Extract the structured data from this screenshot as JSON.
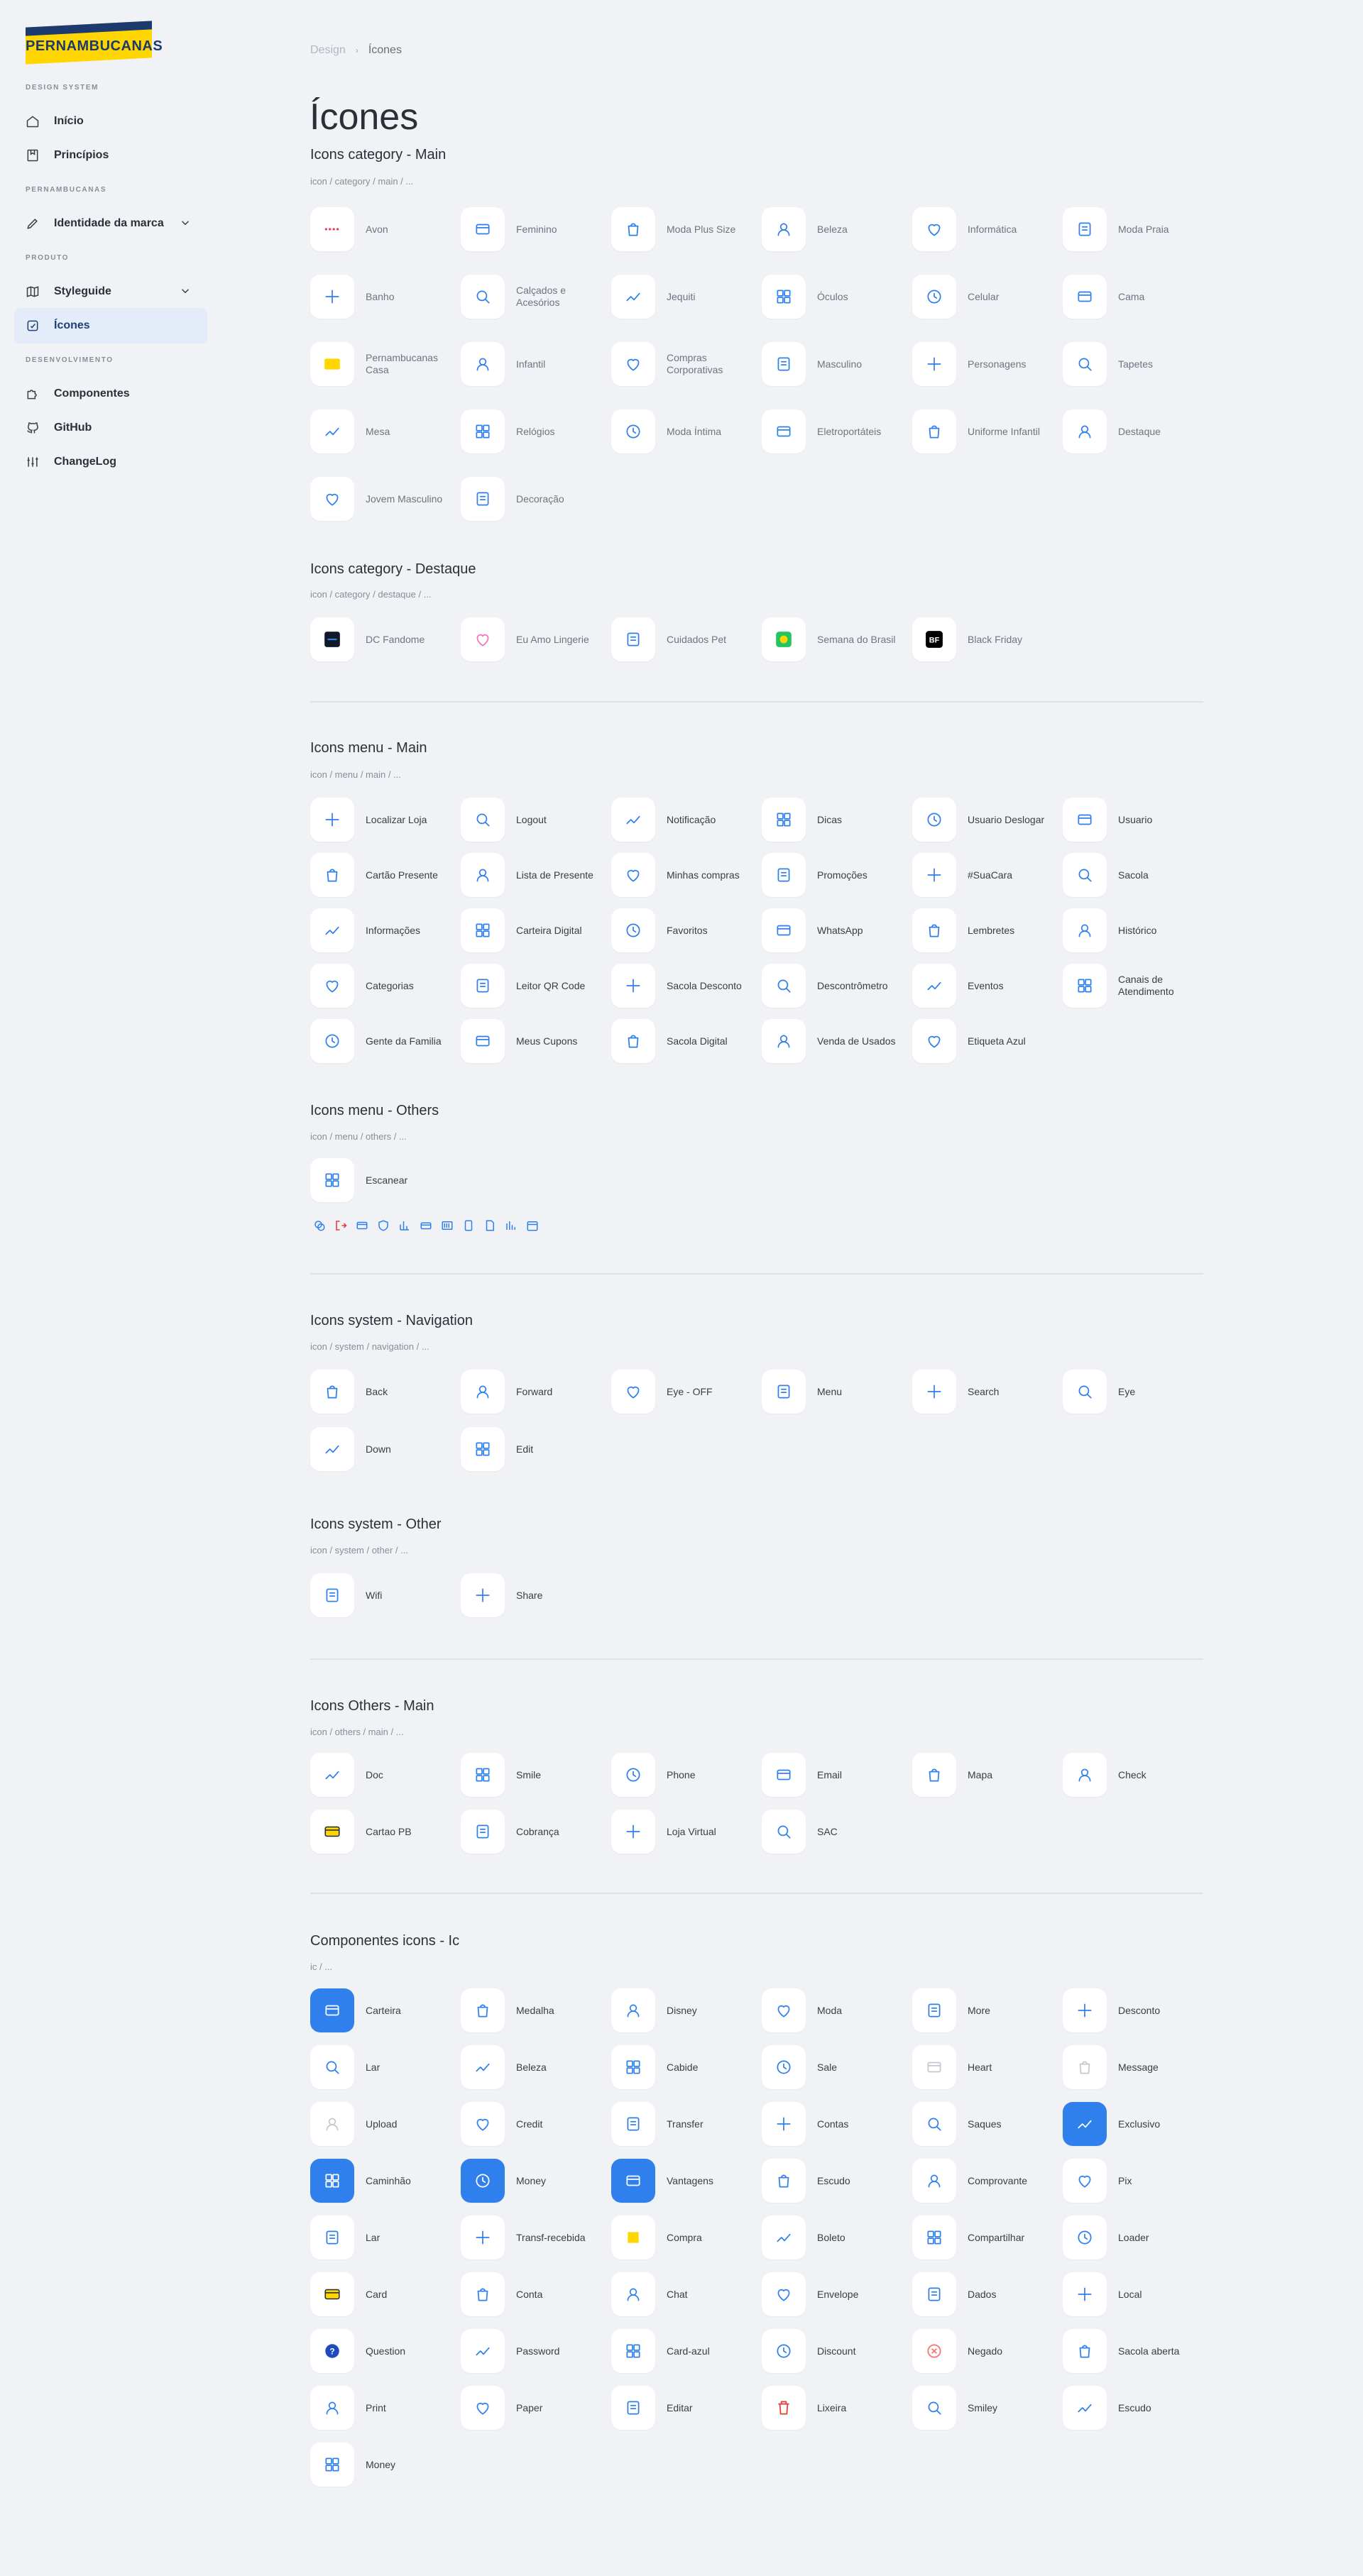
{
  "brand": {
    "name": "PERNAMBUCANAS",
    "accent": "#2f80ed",
    "yellow": "#ffd600",
    "navy": "#1c3a6e"
  },
  "sidebar": {
    "sections": [
      "DESIGN SYSTEM",
      "PERNAMBUCANAS",
      "PRODUTO",
      "DESENVOLVIMENTO"
    ],
    "items": [
      {
        "label": "Início",
        "icon": "home-icon"
      },
      {
        "label": "Princípios",
        "icon": "bookmark-icon"
      },
      {
        "label": "Identidade da marca",
        "icon": "pen-icon"
      },
      {
        "label": "Styleguide",
        "icon": "map-icon"
      },
      {
        "label": "Ícones",
        "icon": "edit-square-icon"
      },
      {
        "label": "Componentes",
        "icon": "puzzle-icon"
      },
      {
        "label": "GitHub",
        "icon": "github-icon"
      },
      {
        "label": "ChangeLog",
        "icon": "sliders-icon"
      }
    ]
  },
  "breadcrumb": {
    "parent": "Design",
    "current": "Ícones"
  },
  "page": {
    "title": "Ícones"
  },
  "sections": [
    {
      "title": "Icons category - Main",
      "path": "icon / category / main / ...",
      "items": [
        "Avon",
        "Feminino",
        "Moda Plus Size",
        "Beleza",
        "Informática",
        "Moda Praia",
        "Banho",
        "Calçados e Acesórios",
        "Jequiti",
        "Óculos",
        "Celular",
        "Cama",
        "Pernambucanas Casa",
        "Infantil",
        "Compras Corporativas",
        "Masculino",
        "Personagens",
        "Tapetes",
        "Mesa",
        "Relógios",
        "Moda Íntima",
        "Eletroportáteis",
        "Uniforme Infantil",
        "Destaque",
        "Jovem Masculino",
        "Decoração"
      ]
    },
    {
      "title": "Icons category - Destaque",
      "path": "icon / category / destaque / ...",
      "items": [
        "DC Fandome",
        "Eu Amo Lingerie",
        "Cuidados Pet",
        "Semana do Brasil",
        "Black Friday"
      ]
    },
    {
      "title": "Icons menu - Main",
      "path": "icon / menu / main / ...",
      "items": [
        "Localizar Loja",
        "Logout",
        "Notificação",
        "Dicas",
        "Usuario Deslogar",
        "Usuario",
        "Cartão Presente",
        "Lista de Presente",
        "Minhas compras",
        "Promoções",
        "#SuaCara",
        "Sacola",
        "Informações",
        "Carteira Digital",
        "Favoritos",
        "WhatsApp",
        "Lembretes",
        "Histórico",
        "Categorias",
        "Leitor QR Code",
        "Sacola Desconto",
        "Descontrômetro",
        "Eventos",
        "Canais de Atendimento",
        "Gente da Familia",
        "Meus Cupons",
        "Sacola Digital",
        "Venda de Usados",
        "Etiqueta Azul"
      ]
    },
    {
      "title": "Icons menu - Others",
      "path": "icon / menu / others / ...",
      "items": [
        "Escanear"
      ]
    },
    {
      "title": "Icons system - Navigation",
      "path": "icon / system / navigation / ...",
      "items": [
        "Back",
        "Forward",
        "Eye - OFF",
        "Menu",
        "Search",
        "Eye",
        "Down",
        "Edit"
      ]
    },
    {
      "title": "Icons system - Other",
      "path": "icon / system / other / ...",
      "items": [
        "Wifi",
        "Share"
      ]
    },
    {
      "title": "Icons Others - Main",
      "path": "icon / others / main / ...",
      "items": [
        "Doc",
        "Smile",
        "Phone",
        "Email",
        "Mapa",
        "Check",
        "Cartao PB",
        "Cobrança",
        "Loja Virtual",
        "SAC"
      ]
    },
    {
      "title": "Componentes icons - Ic",
      "path": "ic / ...",
      "items": [
        "Carteira",
        "Medalha",
        "Disney",
        "Moda",
        "More",
        "Desconto",
        "Lar",
        "Beleza",
        "Cabide",
        "Sale",
        "Heart",
        "Message",
        "Upload",
        "Credit",
        "Transfer",
        "Contas",
        "Saques",
        "Exclusivo",
        "Caminhão",
        "Money",
        "Vantagens",
        "Escudo",
        "Comprovante",
        "Pix",
        "Lar",
        "Transf-recebida",
        "Compra",
        "Boleto",
        "Compartilhar",
        "Loader",
        "Card",
        "Conta",
        "Chat",
        "Envelope",
        "Dados",
        "Local",
        "Question",
        "Password",
        "Card-azul",
        "Discount",
        "Negado",
        "Sacola aberta",
        "Print",
        "Paper",
        "Editar",
        "Lixeira",
        "Smiley",
        "Escudo",
        "Money"
      ]
    }
  ]
}
